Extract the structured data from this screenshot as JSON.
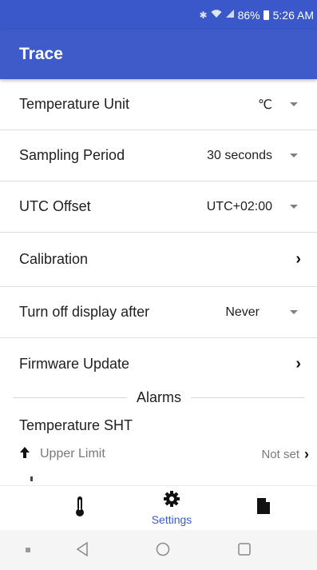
{
  "status_bar": {
    "bluetooth_icon": "bluetooth-icon",
    "wifi_icon": "wifi-icon",
    "signal_icon": "signal-icon",
    "battery_percent": "86%",
    "battery_icon": "battery-icon",
    "time": "5:26 AM"
  },
  "app_bar": {
    "title": "Trace"
  },
  "settings": [
    {
      "label": "Temperature Unit",
      "value": "℃",
      "control": "dropdown"
    },
    {
      "label": "Sampling Period",
      "value": "30 seconds",
      "control": "dropdown"
    },
    {
      "label": "UTC Offset",
      "value": "UTC+02:00",
      "control": "dropdown"
    },
    {
      "label": "Calibration",
      "value": "",
      "control": "chevron"
    },
    {
      "label": "Turn off display after",
      "value": "Never",
      "control": "dropdown"
    },
    {
      "label": "Firmware Update",
      "value": "",
      "control": "chevron"
    }
  ],
  "alarms": {
    "header": "Alarms",
    "section_title": "Temperature SHT",
    "upper_limit": {
      "label": "Upper Limit",
      "value": "Not set"
    }
  },
  "bottom_nav": [
    {
      "icon": "thermometer-icon",
      "label": ""
    },
    {
      "icon": "gear-icon",
      "label": "Settings",
      "selected": true
    },
    {
      "icon": "document-icon",
      "label": ""
    }
  ],
  "system_nav": [
    "recent-dot-icon",
    "back-icon",
    "home-icon",
    "overview-icon"
  ],
  "colors": {
    "primary": "#3f5bc9",
    "status_bar": "#3a58c9",
    "divider": "#e0e0e0",
    "muted_text": "#7a7a7a"
  }
}
